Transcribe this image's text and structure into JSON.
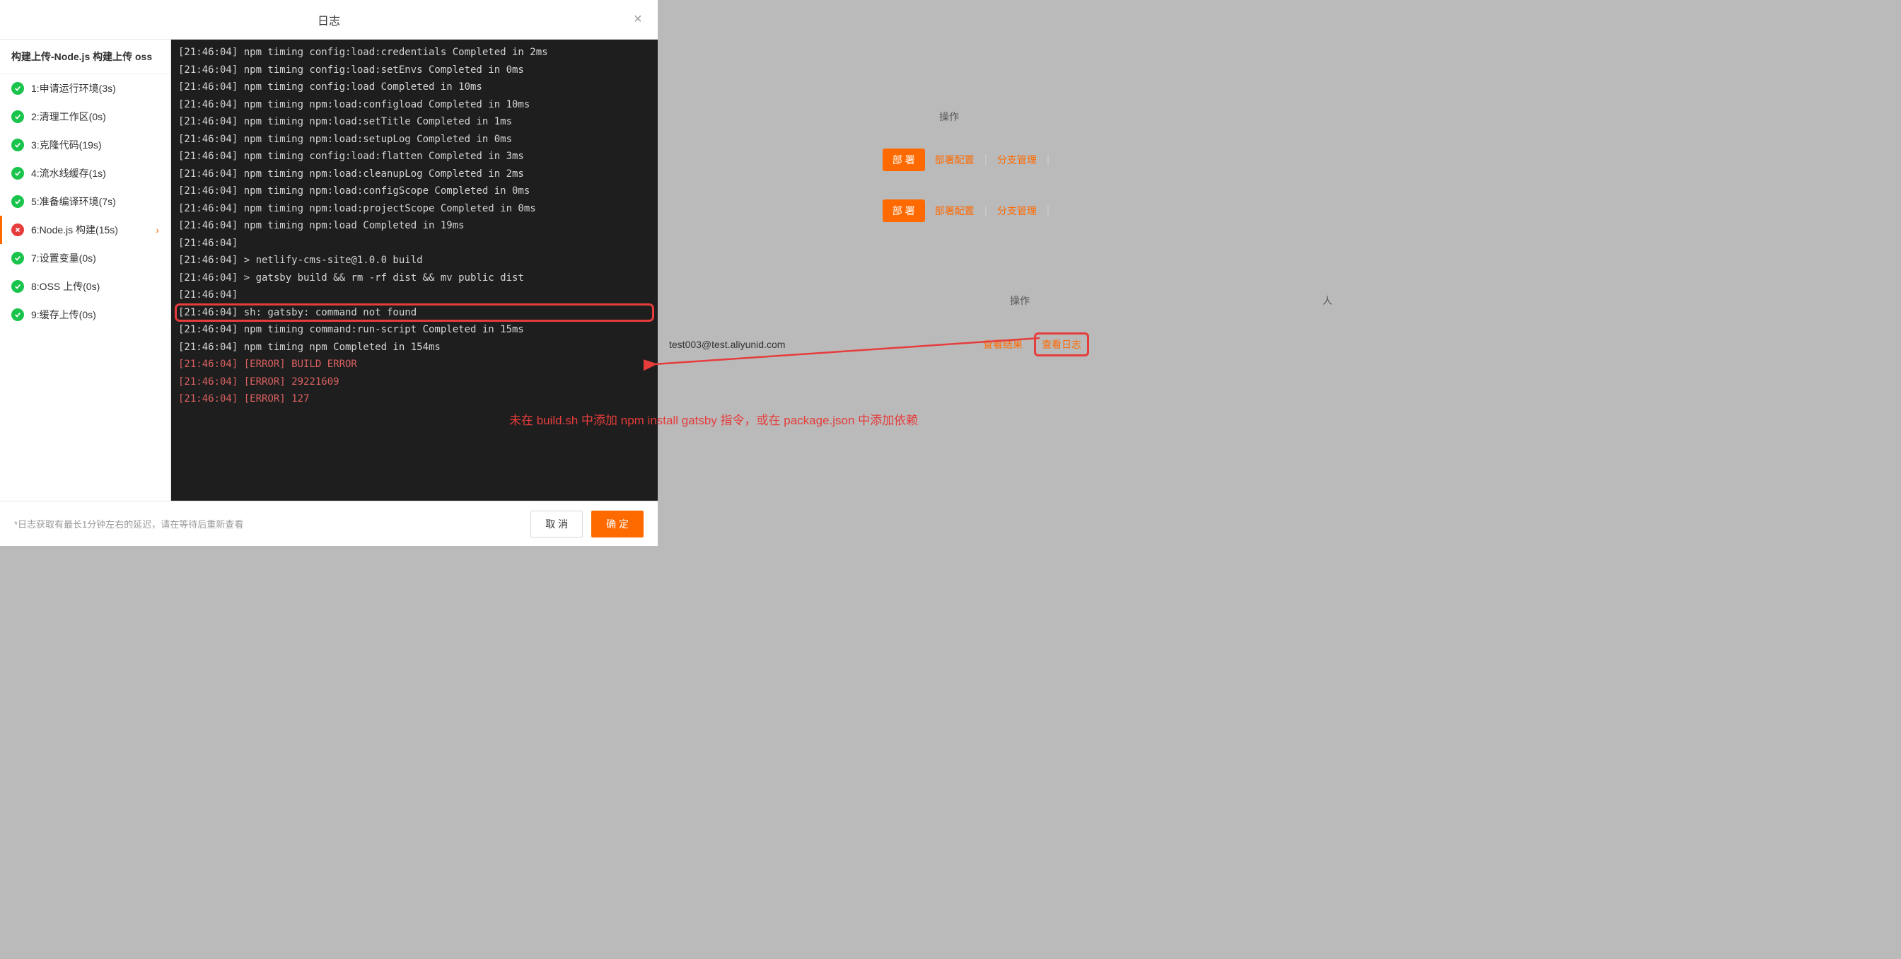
{
  "modal": {
    "title": "日志",
    "close_label": "×"
  },
  "sidebar": {
    "title": "构建上传-Node.js 构建上传 oss",
    "steps": [
      {
        "label": "1:申请运行环境(3s)",
        "status": "success"
      },
      {
        "label": "2:清理工作区(0s)",
        "status": "success"
      },
      {
        "label": "3:克隆代码(19s)",
        "status": "success"
      },
      {
        "label": "4:流水线缓存(1s)",
        "status": "success"
      },
      {
        "label": "5:准备编译环境(7s)",
        "status": "success"
      },
      {
        "label": "6:Node.js 构建(15s)",
        "status": "error",
        "active": true
      },
      {
        "label": "7:设置变量(0s)",
        "status": "success"
      },
      {
        "label": "8:OSS 上传(0s)",
        "status": "success"
      },
      {
        "label": "9:缓存上传(0s)",
        "status": "success"
      }
    ]
  },
  "log": {
    "lines": [
      {
        "text": "[21:46:04] npm timing config:load:credentials Completed in 2ms"
      },
      {
        "text": "[21:46:04] npm timing config:load:setEnvs Completed in 0ms"
      },
      {
        "text": "[21:46:04] npm timing config:load Completed in 10ms"
      },
      {
        "text": "[21:46:04] npm timing npm:load:configload Completed in 10ms"
      },
      {
        "text": "[21:46:04] npm timing npm:load:setTitle Completed in 1ms"
      },
      {
        "text": "[21:46:04] npm timing npm:load:setupLog Completed in 0ms"
      },
      {
        "text": "[21:46:04] npm timing config:load:flatten Completed in 3ms"
      },
      {
        "text": "[21:46:04] npm timing npm:load:cleanupLog Completed in 2ms"
      },
      {
        "text": "[21:46:04] npm timing npm:load:configScope Completed in 0ms"
      },
      {
        "text": "[21:46:04] npm timing npm:load:projectScope Completed in 0ms"
      },
      {
        "text": "[21:46:04] npm timing npm:load Completed in 19ms"
      },
      {
        "text": "[21:46:04]"
      },
      {
        "text": "[21:46:04] > netlify-cms-site@1.0.0 build"
      },
      {
        "text": "[21:46:04] > gatsby build && rm -rf dist && mv public dist"
      },
      {
        "text": "[21:46:04]"
      },
      {
        "text": "[21:46:04] sh: gatsby: command not found",
        "highlight": true
      },
      {
        "text": "[21:46:04] npm timing command:run-script Completed in 15ms"
      },
      {
        "text": "[21:46:04] npm timing npm Completed in 154ms"
      },
      {
        "text": "[21:46:04] [ERROR] BUILD ERROR",
        "error": true
      },
      {
        "text": "[21:46:04] [ERROR] 29221609",
        "error": true
      },
      {
        "text": "[21:46:04] [ERROR] 127",
        "error": true
      }
    ]
  },
  "footer": {
    "hint": "*日志获取有最长1分钟左右的延迟，请在等待后重新查看",
    "cancel": "取 消",
    "ok": "确 定"
  },
  "background": {
    "ops_header": "操作",
    "person_header": "人",
    "deploy": "部 署",
    "deploy_config": "部署配置",
    "branch_mgmt": "分支管理",
    "view_result": "查看结",
    "email": "test003@test.aliyunid.com",
    "view_result2": "查看结果",
    "view_log": "查看日志"
  },
  "annotation": "未在 build.sh 中添加 npm install gatsby 指令，或在 package.json 中添加依赖"
}
